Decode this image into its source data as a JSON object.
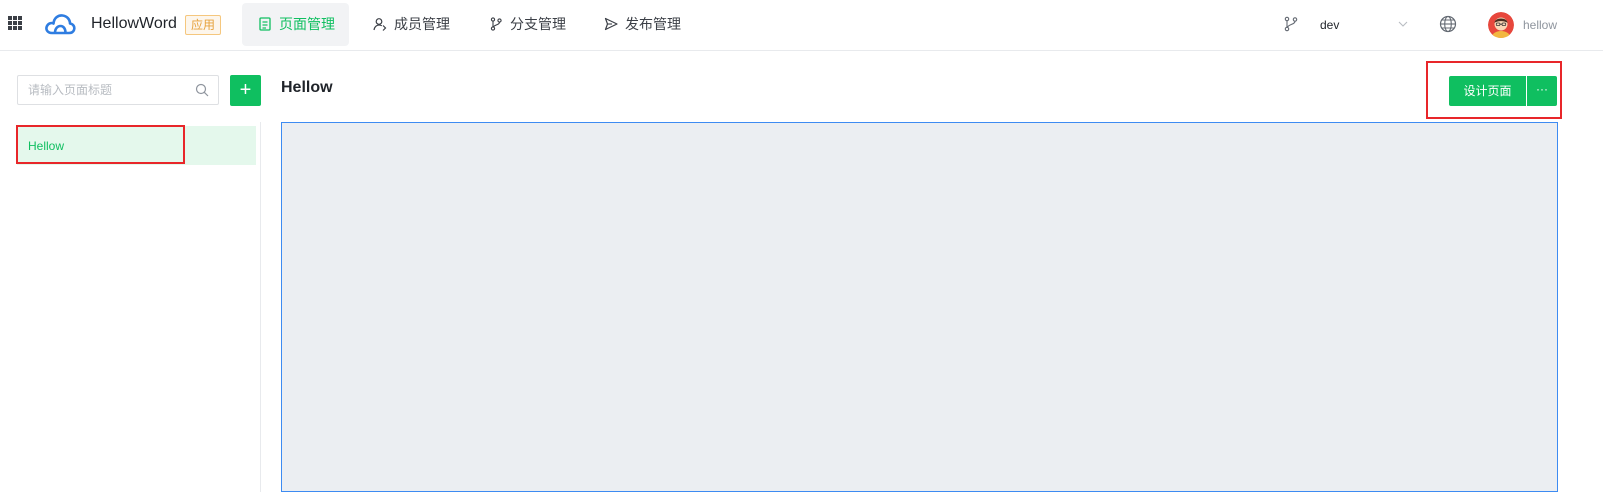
{
  "header": {
    "app_name": "HellowWord",
    "app_tag": "应用",
    "tabs": [
      {
        "label": "页面管理",
        "icon": "page-icon",
        "active": true
      },
      {
        "label": "成员管理",
        "icon": "members-icon",
        "active": false
      },
      {
        "label": "分支管理",
        "icon": "branch-icon",
        "active": false
      },
      {
        "label": "发布管理",
        "icon": "publish-icon",
        "active": false
      }
    ],
    "branch": "dev",
    "username": "hellow"
  },
  "sidebar": {
    "search_placeholder": "请输入页面标题",
    "add_label": "+",
    "pages": [
      {
        "label": "Hellow",
        "selected": true
      }
    ]
  },
  "main": {
    "page_title": "Hellow",
    "design_label": "设计页面",
    "more_label": "···"
  },
  "colors": {
    "accent": "#0fbf60",
    "selected_bg": "#e4f8ec",
    "canvas_bg": "#ebeef2",
    "canvas_border": "#3d8bf2",
    "highlight": "#e8262a",
    "tag": "#e6a23c"
  }
}
